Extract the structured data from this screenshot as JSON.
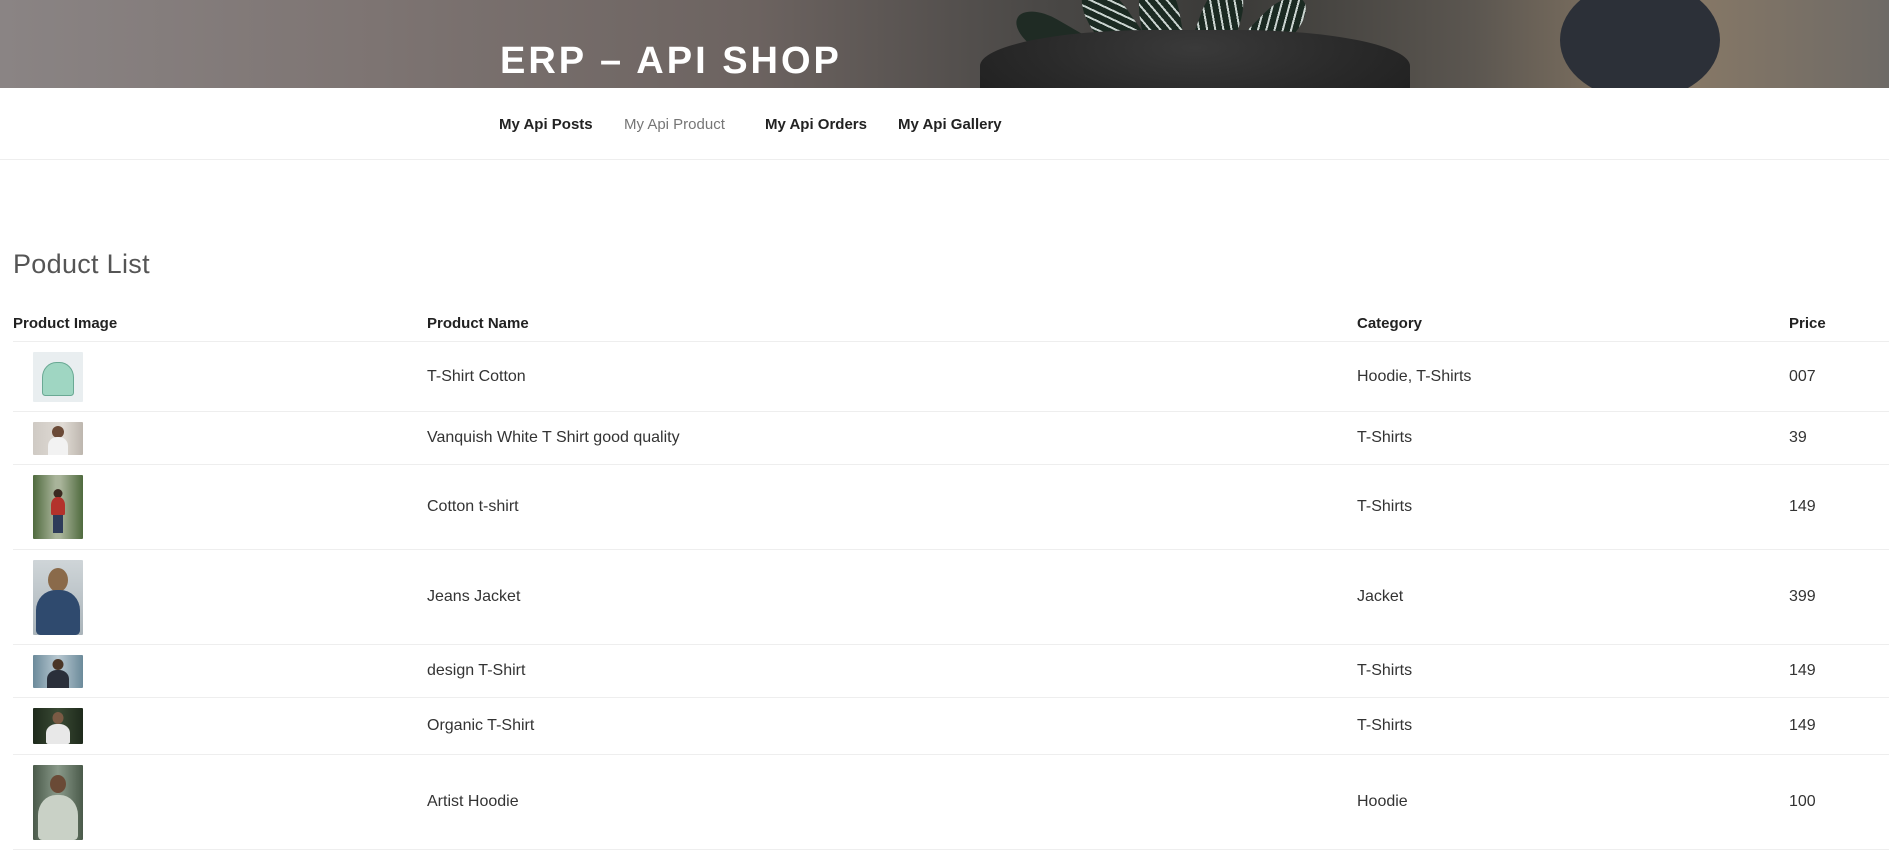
{
  "site": {
    "title": "ERP – API SHOP"
  },
  "nav": {
    "items": [
      {
        "label": "My Api Posts",
        "active": false
      },
      {
        "label": "My Api Product",
        "active": true
      },
      {
        "label": "My Api Orders",
        "active": false
      },
      {
        "label": "My Api Gallery",
        "active": false
      }
    ]
  },
  "page": {
    "title": "Poduct List"
  },
  "table": {
    "headers": [
      "Product Image",
      "Product Name",
      "Category",
      "Price"
    ],
    "rows": [
      {
        "image": "hoodie-photo",
        "name": "T-Shirt Cotton",
        "category": "Hoodie, T-Shirts",
        "price": "007"
      },
      {
        "image": "woman-tshirt-photo",
        "name": "Vanquish White T Shirt good quality",
        "category": "T-Shirts",
        "price": "39"
      },
      {
        "image": "man-red-shirt-photo",
        "name": "Cotton t-shirt",
        "category": "T-Shirts",
        "price": "149"
      },
      {
        "image": "jeans-jacket-photo",
        "name": "Jeans Jacket",
        "category": "Jacket",
        "price": "399"
      },
      {
        "image": "design-tshirt-photo",
        "name": "design T-Shirt",
        "category": "T-Shirts",
        "price": "149"
      },
      {
        "image": "organic-tshirt-photo",
        "name": "Organic T-Shirt",
        "category": "T-Shirts",
        "price": "149"
      },
      {
        "image": "artist-hoodie-photo",
        "name": "Artist Hoodie",
        "category": "Hoodie",
        "price": "100"
      }
    ]
  }
}
